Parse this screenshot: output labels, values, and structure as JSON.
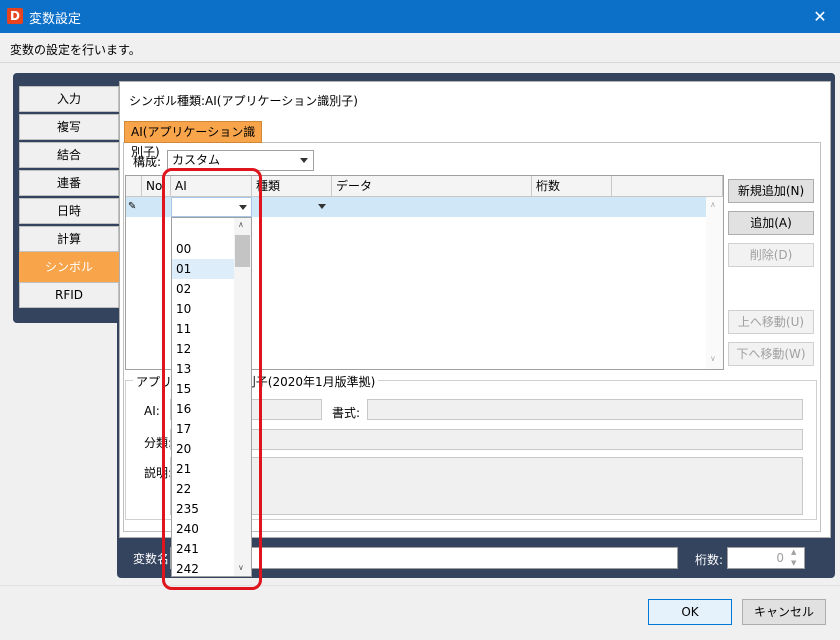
{
  "window": {
    "title": "変数設定",
    "subtitle": "変数の設定を行います。",
    "close_glyph": "✕"
  },
  "sidebar": {
    "items": [
      {
        "label": "入力"
      },
      {
        "label": "複写"
      },
      {
        "label": "結合"
      },
      {
        "label": "連番"
      },
      {
        "label": "日時"
      },
      {
        "label": "計算"
      },
      {
        "label": "シンボル",
        "active": true
      },
      {
        "label": "RFID"
      }
    ]
  },
  "main": {
    "symbol_type": "シンボル種類:AI(アプリケーション識別子)",
    "sub_tab": "AI(アプリケーション識別子)",
    "config_label": "構成:",
    "config_value": "カスタム",
    "grid": {
      "columns": [
        "No",
        "AI",
        "種類",
        "データ",
        "桁数",
        ""
      ]
    },
    "dropdown_options": [
      "",
      "00",
      "01",
      "02",
      "10",
      "11",
      "12",
      "13",
      "15",
      "16",
      "17",
      "20",
      "21",
      "22",
      "235",
      "240",
      "241",
      "242"
    ],
    "dropdown_selected": "01",
    "buttons": {
      "new_add": "新規追加(N)",
      "add": "追加(A)",
      "delete": "削除(D)",
      "move_up": "上へ移動(U)",
      "move_down": "下へ移動(W)"
    },
    "app_group_label": "アプリケーション識別子(2020年1月版準拠)",
    "fields": {
      "ai": "AI:",
      "format": "書式:",
      "category": "分類:",
      "description": "説明:"
    },
    "varname_label": "変数名:",
    "digits_label": "桁数:",
    "digits_value": "0"
  },
  "footer": {
    "ok": "OK",
    "cancel": "キャンセル"
  },
  "colors": {
    "titlebar": "#0c70c9",
    "accent": "#f7a44b",
    "panel": "#34445e",
    "highlight": "#e0141c"
  }
}
